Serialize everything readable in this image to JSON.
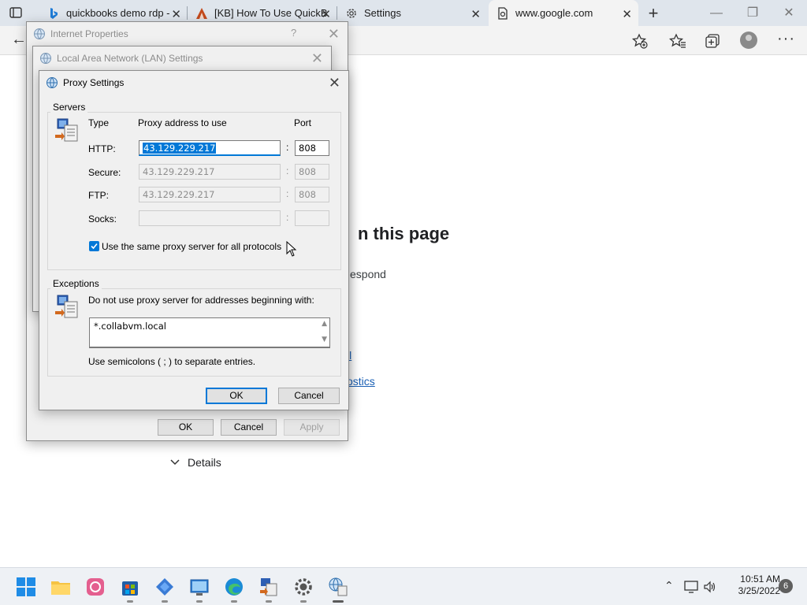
{
  "browser": {
    "tabs": [
      {
        "label": "quickbooks demo rdp -",
        "icon": "bing-icon"
      },
      {
        "label": "[KB] How To Use QuickB",
        "icon": "kb-icon"
      },
      {
        "label": "Settings",
        "icon": "gear-icon"
      },
      {
        "label": "www.google.com",
        "icon": "page-error-icon"
      }
    ],
    "window_controls": {
      "minimize": "—",
      "restore": "❐",
      "close": "✕"
    }
  },
  "page": {
    "heading_fragment": "n this page",
    "text_fragment": "espond",
    "link1_fragment": "ll",
    "link2_fragment": "ostics",
    "details_label": "Details"
  },
  "internet_properties": {
    "title": "Internet Properties",
    "help": "?",
    "ok": "OK",
    "cancel": "Cancel",
    "apply": "Apply"
  },
  "lan_settings": {
    "title": "Local Area Network (LAN) Settings"
  },
  "proxy_settings": {
    "title": "Proxy Settings",
    "servers_label": "Servers",
    "col_type": "Type",
    "col_address": "Proxy address to use",
    "col_port": "Port",
    "rows": [
      {
        "type": "HTTP:",
        "address": "43.129.229.217",
        "port": "808"
      },
      {
        "type": "Secure:",
        "address": "43.129.229.217",
        "port": "808"
      },
      {
        "type": "FTP:",
        "address": "43.129.229.217",
        "port": "808"
      },
      {
        "type": "Socks:",
        "address": "",
        "port": ""
      }
    ],
    "same_proxy_label": "Use the same proxy server for all protocols",
    "same_proxy_checked": true,
    "exceptions_label": "Exceptions",
    "exceptions_desc": "Do not use proxy server for addresses beginning with:",
    "exceptions_value": "*.collabvm.local",
    "exceptions_hint": "Use semicolons ( ; ) to separate entries.",
    "ok": "OK",
    "cancel": "Cancel"
  },
  "taskbar": {
    "apps": [
      "start-icon",
      "file-explorer-icon",
      "photos-icon",
      "store-icon",
      "copilot-icon",
      "control-panel-icon",
      "edge-icon",
      "network-admin-icon",
      "settings-icon",
      "internet-options-icon"
    ],
    "time": "10:51 AM",
    "date": "3/25/2022",
    "notification_count": "6"
  },
  "colors": {
    "accent": "#0078d7",
    "link": "#1a5fb4",
    "tab_bar": "#dfe5ec",
    "dialog_bg": "#f0f0f0"
  }
}
